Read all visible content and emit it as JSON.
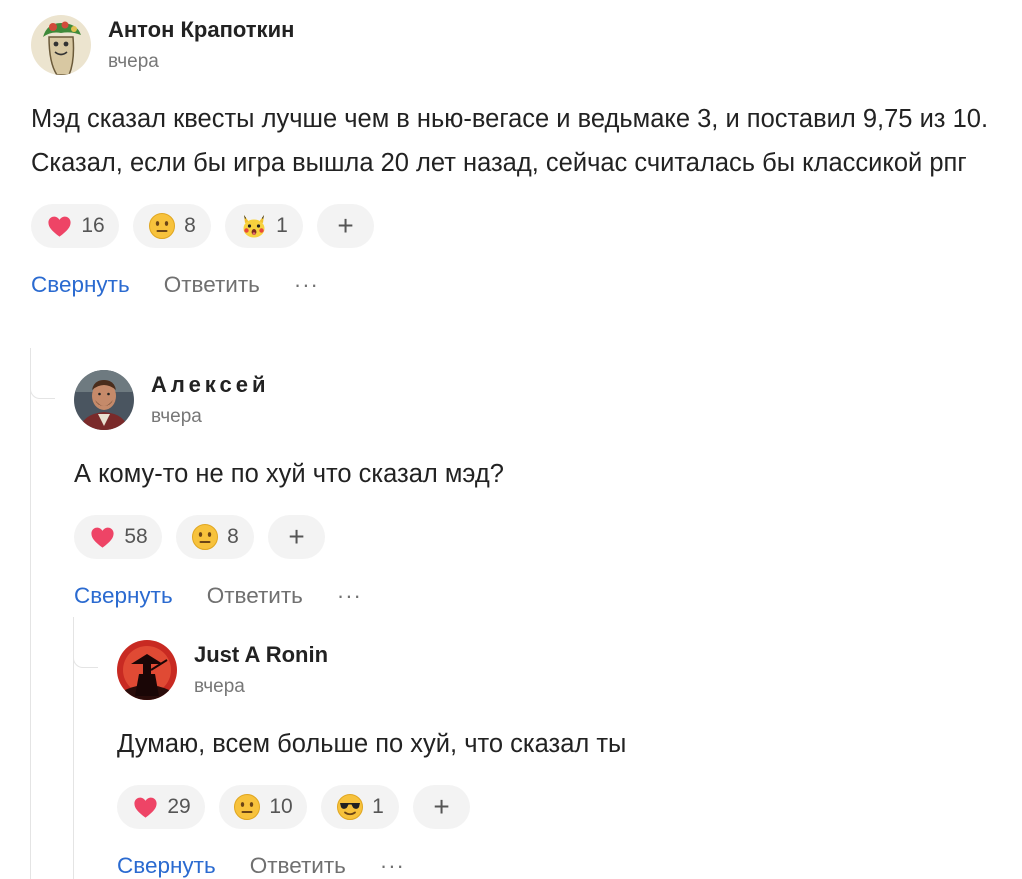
{
  "comments": [
    {
      "author": "Антон Крапоткин",
      "time": "вчера",
      "text": "Мэд сказал квесты лучше чем в нью-вегасе и ведьмаке 3, и поставил 9,75 из 10. Сказал, если бы игра вышла 20 лет назад, сейчас считалась бы классикой рпг",
      "reactions": [
        {
          "icon": "heart-icon",
          "count": "16"
        },
        {
          "icon": "neutral-face-icon",
          "count": "8"
        },
        {
          "icon": "pikachu-shocked-icon",
          "count": "1"
        }
      ],
      "add_label": "+",
      "collapse_label": "Свернуть",
      "reply_label": "Ответить",
      "more_label": "···"
    },
    {
      "author": "Алексей",
      "time": "вчера",
      "text": "А кому-то не по хуй что сказал мэд?",
      "reactions": [
        {
          "icon": "heart-icon",
          "count": "58"
        },
        {
          "icon": "neutral-face-icon",
          "count": "8"
        }
      ],
      "add_label": "+",
      "collapse_label": "Свернуть",
      "reply_label": "Ответить",
      "more_label": "···"
    },
    {
      "author": "Just A Ronin",
      "time": "вчера",
      "text": "Думаю, всем больше по хуй, что сказал ты",
      "reactions": [
        {
          "icon": "heart-icon",
          "count": "29"
        },
        {
          "icon": "neutral-face-icon",
          "count": "10"
        },
        {
          "icon": "sunglasses-face-icon",
          "count": "1"
        }
      ],
      "add_label": "+",
      "collapse_label": "Свернуть",
      "reply_label": "Ответить",
      "more_label": "···"
    }
  ],
  "colors": {
    "accent": "#2a6ad0",
    "muted": "#707070",
    "pill_bg": "#f3f3f3",
    "heart": "#ee4466"
  }
}
